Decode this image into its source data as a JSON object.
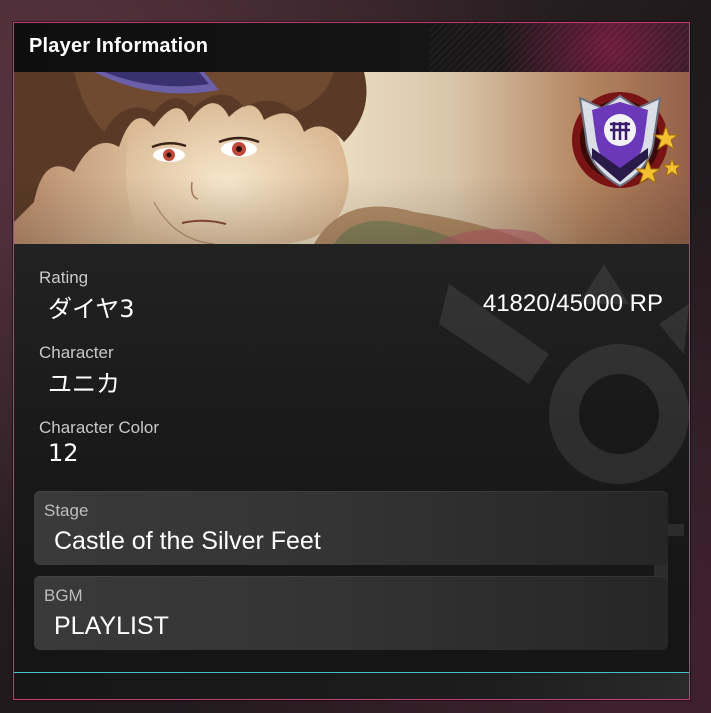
{
  "panel": {
    "title": "Player Information"
  },
  "banner": {
    "character_art": "character-portrait",
    "rank_emblem": "diamond-rank-emblem-icon",
    "stars": 3
  },
  "rating": {
    "label": "Rating",
    "value": "ダイヤ3",
    "points": "41820/45000 RP"
  },
  "character": {
    "label": "Character",
    "value": "ユニカ"
  },
  "character_color": {
    "label": "Character Color",
    "value": "12"
  },
  "stage": {
    "label": "Stage",
    "value": "Castle of the Silver Feet"
  },
  "bgm": {
    "label": "BGM",
    "value": "PLAYLIST"
  },
  "colors": {
    "accent_pink": "#f0468c",
    "accent_cyan": "#3cc6c9",
    "panel_bg": "#1b1b1b"
  }
}
